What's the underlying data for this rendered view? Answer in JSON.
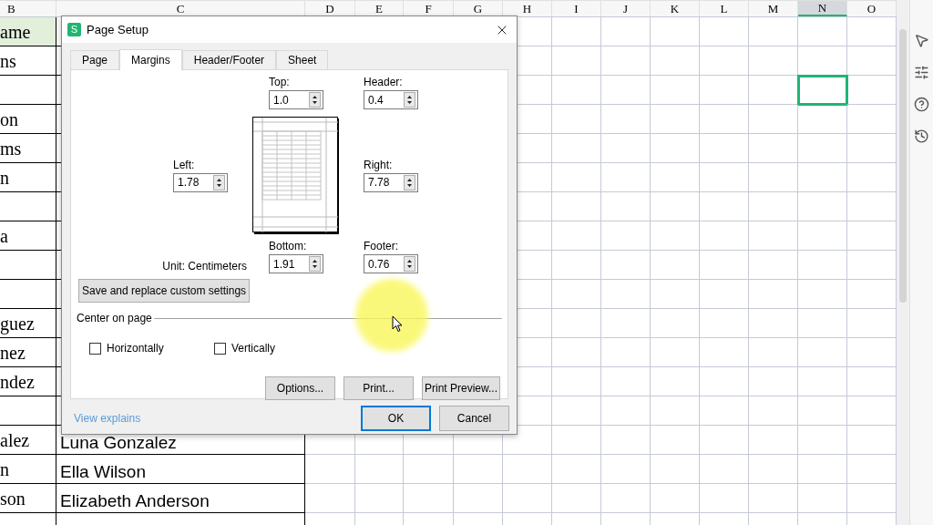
{
  "sheet": {
    "columns": [
      {
        "label": "B",
        "selected": false
      },
      {
        "label": "C",
        "selected": false
      },
      {
        "label": "D",
        "selected": false
      },
      {
        "label": "E",
        "selected": false
      },
      {
        "label": "F",
        "selected": false
      },
      {
        "label": "G",
        "selected": false
      },
      {
        "label": "H",
        "selected": false
      },
      {
        "label": "I",
        "selected": false
      },
      {
        "label": "J",
        "selected": false
      },
      {
        "label": "K",
        "selected": false
      },
      {
        "label": "L",
        "selected": false
      },
      {
        "label": "M",
        "selected": false
      },
      {
        "label": "N",
        "selected": true
      },
      {
        "label": "O",
        "selected": false
      }
    ],
    "rows": [
      {
        "kind": "header",
        "column_b": "ame",
        "selected": false
      },
      {
        "kind": "data",
        "column_b": "ns",
        "selected": false
      },
      {
        "kind": "data",
        "selected": true
      },
      {
        "kind": "data",
        "column_b": "on",
        "selected": false
      },
      {
        "kind": "data",
        "column_b": "ms",
        "selected": false
      },
      {
        "kind": "data",
        "column_b": "n",
        "selected": false
      },
      {
        "kind": "data",
        "selected": false
      },
      {
        "kind": "data",
        "column_b": "a",
        "selected": false
      },
      {
        "kind": "data",
        "selected": false
      },
      {
        "kind": "data",
        "selected": false
      },
      {
        "kind": "data",
        "column_b": "guez",
        "selected": false
      },
      {
        "kind": "data",
        "column_b": "nez",
        "selected": false
      },
      {
        "kind": "data",
        "column_b": "ndez",
        "selected": false
      },
      {
        "kind": "data",
        "selected": false
      },
      {
        "kind": "data",
        "column_b": "alez",
        "column_c": "Luna Gonzalez",
        "selected": false
      },
      {
        "kind": "data",
        "column_b": "n",
        "column_c": "Ella Wilson",
        "selected": false
      },
      {
        "kind": "data",
        "column_b": "son",
        "column_c": "Elizabeth Anderson",
        "selected": false
      },
      {
        "kind": "data",
        "selected": false
      }
    ]
  },
  "dialog": {
    "icon_text": "S",
    "title": "Page Setup",
    "tabs": [
      {
        "label": "Page",
        "selected": false
      },
      {
        "label": "Margins",
        "selected": true
      },
      {
        "label": "Header/Footer",
        "selected": false
      },
      {
        "label": "Sheet",
        "selected": false
      }
    ],
    "margins": {
      "top": {
        "label": "Top:",
        "value": "1.0"
      },
      "header": {
        "label": "Header:",
        "value": "0.4"
      },
      "left": {
        "label": "Left:",
        "value": "1.78"
      },
      "right": {
        "label": "Right:",
        "value": "7.78"
      },
      "bottom": {
        "label": "Bottom:",
        "value": "1.91"
      },
      "footer": {
        "label": "Footer:",
        "value": "0.76"
      }
    },
    "unit": "Unit: Centimeters",
    "save_button": "Save and replace custom settings",
    "center_on_page": {
      "title": "Center on page",
      "options": [
        {
          "label": "Horizontally",
          "checked": false
        },
        {
          "label": "Vertically",
          "checked": false
        }
      ]
    },
    "buttons": [
      "Options...",
      "Print...",
      "Print Preview..."
    ],
    "link": "View explains",
    "footer_buttons": [
      {
        "label": "OK",
        "default": true
      },
      {
        "label": "Cancel",
        "default": false
      }
    ]
  }
}
